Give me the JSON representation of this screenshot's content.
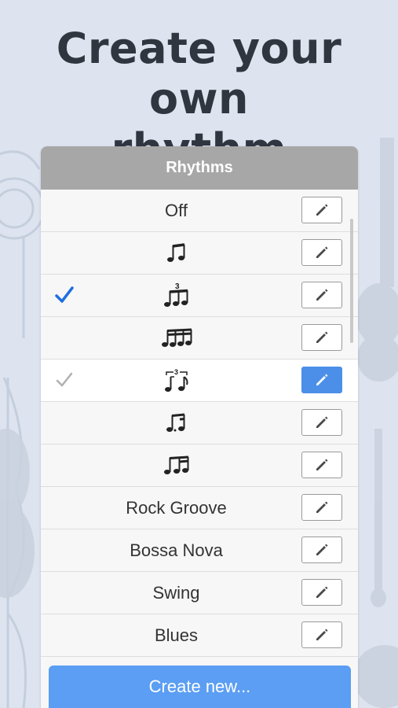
{
  "headline": {
    "line1": "Create your own",
    "line2": "rhythm"
  },
  "panel": {
    "title": "Rhythms",
    "rows": [
      {
        "label": "Off",
        "kind": "text",
        "check": "none",
        "edit_active": false
      },
      {
        "label": "",
        "kind": "eighth-pair-icon",
        "check": "none",
        "edit_active": false
      },
      {
        "label": "",
        "kind": "triplet-eighths-icon",
        "check": "blue",
        "edit_active": false
      },
      {
        "label": "",
        "kind": "sixteenths-icon",
        "check": "none",
        "edit_active": false
      },
      {
        "label": "",
        "kind": "swing-triplet-icon",
        "check": "gray",
        "edit_active": true
      },
      {
        "label": "",
        "kind": "dotted-eighth-sixteenth-icon",
        "check": "none",
        "edit_active": false
      },
      {
        "label": "",
        "kind": "eighth-two-sixteenths-icon",
        "check": "none",
        "edit_active": false
      },
      {
        "label": "Rock Groove",
        "kind": "text",
        "check": "none",
        "edit_active": false
      },
      {
        "label": "Bossa Nova",
        "kind": "text",
        "check": "none",
        "edit_active": false
      },
      {
        "label": "Swing",
        "kind": "text",
        "check": "none",
        "edit_active": false
      },
      {
        "label": "Blues",
        "kind": "text",
        "check": "none",
        "edit_active": false
      }
    ],
    "triplet_number": "3"
  },
  "create_button": {
    "label": "Create new..."
  },
  "colors": {
    "accent": "#4b8fe8",
    "button": "#5b9ef3",
    "header": "#a7a7a7",
    "check_blue": "#1f6fe0",
    "check_gray": "#b0b0b0"
  }
}
